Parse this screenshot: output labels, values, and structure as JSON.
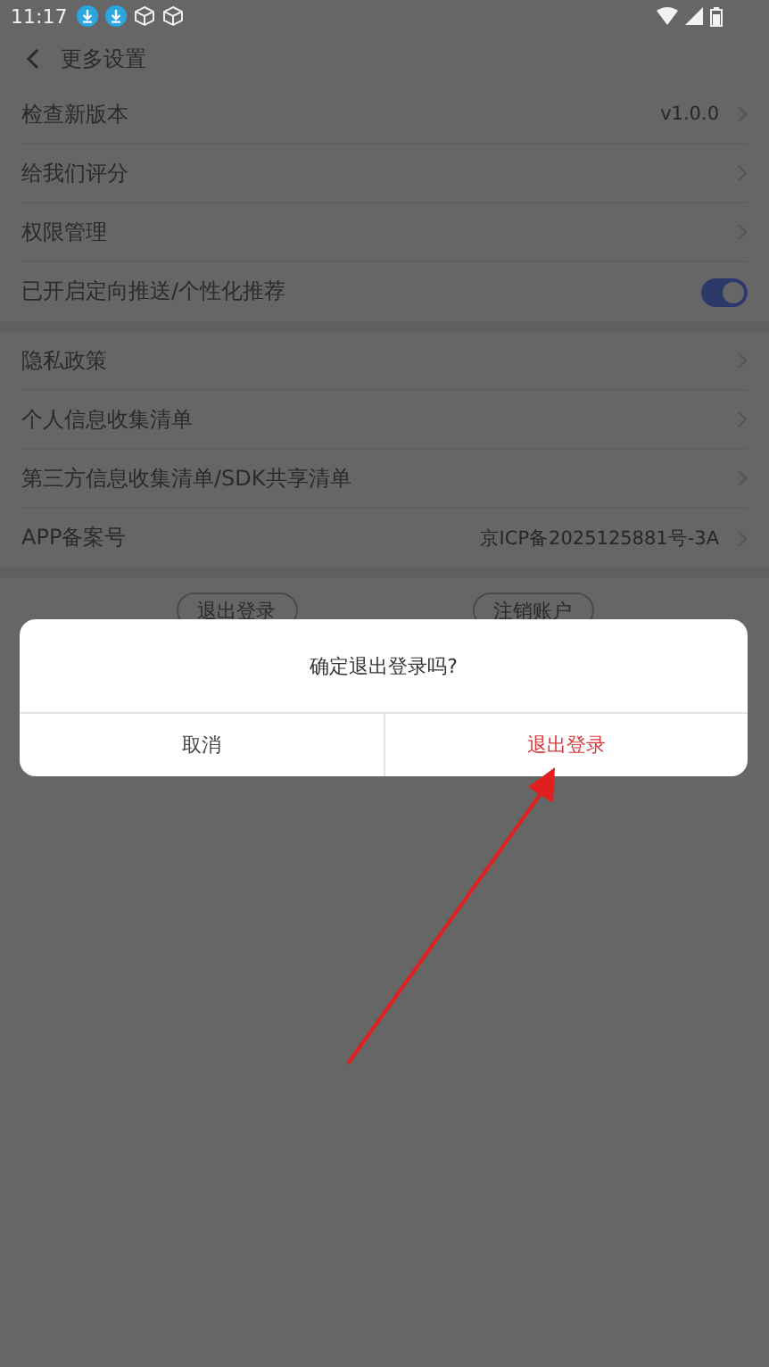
{
  "status_bar": {
    "time": "11:17"
  },
  "header": {
    "title": "更多设置"
  },
  "groups": [
    {
      "items": [
        {
          "kind": "link",
          "label": "检查新版本",
          "value": "v1.0.0"
        },
        {
          "kind": "link",
          "label": "给我们评分"
        },
        {
          "kind": "link",
          "label": "权限管理"
        },
        {
          "kind": "toggle",
          "label": "已开启定向推送/个性化推荐",
          "on": true
        }
      ]
    },
    {
      "items": [
        {
          "kind": "link",
          "label": "隐私政策"
        },
        {
          "kind": "link",
          "label": "个人信息收集清单"
        },
        {
          "kind": "link",
          "label": "第三方信息收集清单/SDK共享清单"
        },
        {
          "kind": "link",
          "label": "APP备案号",
          "value": "京ICP备2025125881号-3A"
        }
      ]
    }
  ],
  "buttons": [
    "退出登录",
    "注销账户"
  ],
  "dialog": {
    "message": "确定退出登录吗?",
    "buttons": [
      {
        "label": "取消",
        "kind": "cancel"
      },
      {
        "label": "退出登录",
        "kind": "confirm"
      }
    ]
  }
}
